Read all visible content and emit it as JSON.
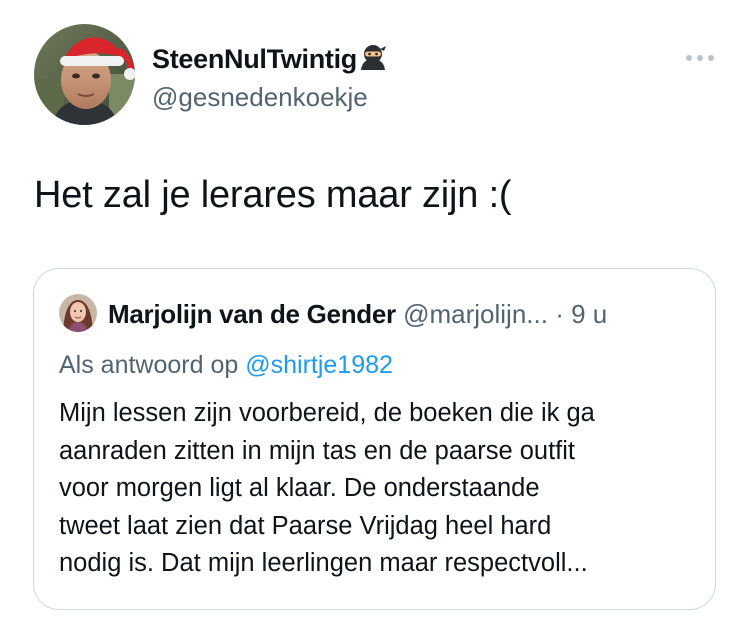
{
  "author": {
    "display_name": "SteenNulTwintig",
    "display_name_emoji": "ninja",
    "handle": "@gesnedenkoekje"
  },
  "menu": {
    "icon": "more-horizontal-icon"
  },
  "tweet": {
    "text": "Het zal je lerares maar zijn :("
  },
  "quoted_tweet": {
    "display_name": "Marjolijn van de Gender",
    "handle": "@marjolijn...",
    "separator": "·",
    "time": "9 u",
    "reply_prefix": "Als antwoord op",
    "reply_to": "@shirtje1982",
    "body_lines": [
      "Mijn lessen zijn voorbereid, de boeken die ik ga",
      "aanraden zitten in mijn tas en de paarse outfit",
      "voor morgen ligt al klaar. De onderstaande",
      "tweet laat zien dat Paarse Vrijdag heel hard",
      "nodig is. Dat mijn leerlingen maar respectvoll..."
    ]
  },
  "colors": {
    "text_primary": "#0f1419",
    "text_secondary": "#536471",
    "link": "#1d9bf0",
    "border": "#cfd9de"
  }
}
